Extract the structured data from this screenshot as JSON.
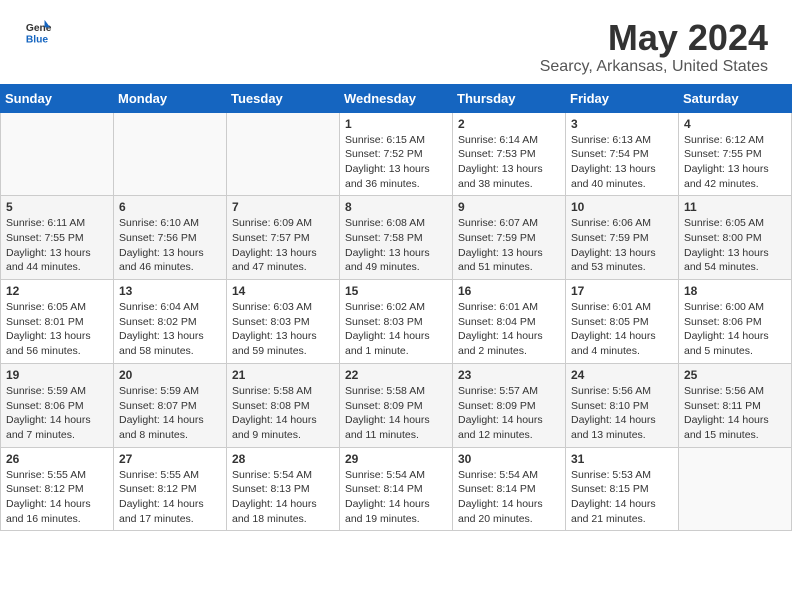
{
  "header": {
    "logo": {
      "line1": "General",
      "line2": "Blue"
    },
    "title": "May 2024",
    "location": "Searcy, Arkansas, United States"
  },
  "weekdays": [
    "Sunday",
    "Monday",
    "Tuesday",
    "Wednesday",
    "Thursday",
    "Friday",
    "Saturday"
  ],
  "weeks": [
    [
      {
        "day": null,
        "data": null
      },
      {
        "day": null,
        "data": null
      },
      {
        "day": null,
        "data": null
      },
      {
        "day": "1",
        "sunrise": "6:15 AM",
        "sunset": "7:52 PM",
        "daylight": "13 hours and 36 minutes."
      },
      {
        "day": "2",
        "sunrise": "6:14 AM",
        "sunset": "7:53 PM",
        "daylight": "13 hours and 38 minutes."
      },
      {
        "day": "3",
        "sunrise": "6:13 AM",
        "sunset": "7:54 PM",
        "daylight": "13 hours and 40 minutes."
      },
      {
        "day": "4",
        "sunrise": "6:12 AM",
        "sunset": "7:55 PM",
        "daylight": "13 hours and 42 minutes."
      }
    ],
    [
      {
        "day": "5",
        "sunrise": "6:11 AM",
        "sunset": "7:55 PM",
        "daylight": "13 hours and 44 minutes."
      },
      {
        "day": "6",
        "sunrise": "6:10 AM",
        "sunset": "7:56 PM",
        "daylight": "13 hours and 46 minutes."
      },
      {
        "day": "7",
        "sunrise": "6:09 AM",
        "sunset": "7:57 PM",
        "daylight": "13 hours and 47 minutes."
      },
      {
        "day": "8",
        "sunrise": "6:08 AM",
        "sunset": "7:58 PM",
        "daylight": "13 hours and 49 minutes."
      },
      {
        "day": "9",
        "sunrise": "6:07 AM",
        "sunset": "7:59 PM",
        "daylight": "13 hours and 51 minutes."
      },
      {
        "day": "10",
        "sunrise": "6:06 AM",
        "sunset": "7:59 PM",
        "daylight": "13 hours and 53 minutes."
      },
      {
        "day": "11",
        "sunrise": "6:05 AM",
        "sunset": "8:00 PM",
        "daylight": "13 hours and 54 minutes."
      }
    ],
    [
      {
        "day": "12",
        "sunrise": "6:05 AM",
        "sunset": "8:01 PM",
        "daylight": "13 hours and 56 minutes."
      },
      {
        "day": "13",
        "sunrise": "6:04 AM",
        "sunset": "8:02 PM",
        "daylight": "13 hours and 58 minutes."
      },
      {
        "day": "14",
        "sunrise": "6:03 AM",
        "sunset": "8:03 PM",
        "daylight": "13 hours and 59 minutes."
      },
      {
        "day": "15",
        "sunrise": "6:02 AM",
        "sunset": "8:03 PM",
        "daylight": "14 hours and 1 minute."
      },
      {
        "day": "16",
        "sunrise": "6:01 AM",
        "sunset": "8:04 PM",
        "daylight": "14 hours and 2 minutes."
      },
      {
        "day": "17",
        "sunrise": "6:01 AM",
        "sunset": "8:05 PM",
        "daylight": "14 hours and 4 minutes."
      },
      {
        "day": "18",
        "sunrise": "6:00 AM",
        "sunset": "8:06 PM",
        "daylight": "14 hours and 5 minutes."
      }
    ],
    [
      {
        "day": "19",
        "sunrise": "5:59 AM",
        "sunset": "8:06 PM",
        "daylight": "14 hours and 7 minutes."
      },
      {
        "day": "20",
        "sunrise": "5:59 AM",
        "sunset": "8:07 PM",
        "daylight": "14 hours and 8 minutes."
      },
      {
        "day": "21",
        "sunrise": "5:58 AM",
        "sunset": "8:08 PM",
        "daylight": "14 hours and 9 minutes."
      },
      {
        "day": "22",
        "sunrise": "5:58 AM",
        "sunset": "8:09 PM",
        "daylight": "14 hours and 11 minutes."
      },
      {
        "day": "23",
        "sunrise": "5:57 AM",
        "sunset": "8:09 PM",
        "daylight": "14 hours and 12 minutes."
      },
      {
        "day": "24",
        "sunrise": "5:56 AM",
        "sunset": "8:10 PM",
        "daylight": "14 hours and 13 minutes."
      },
      {
        "day": "25",
        "sunrise": "5:56 AM",
        "sunset": "8:11 PM",
        "daylight": "14 hours and 15 minutes."
      }
    ],
    [
      {
        "day": "26",
        "sunrise": "5:55 AM",
        "sunset": "8:12 PM",
        "daylight": "14 hours and 16 minutes."
      },
      {
        "day": "27",
        "sunrise": "5:55 AM",
        "sunset": "8:12 PM",
        "daylight": "14 hours and 17 minutes."
      },
      {
        "day": "28",
        "sunrise": "5:54 AM",
        "sunset": "8:13 PM",
        "daylight": "14 hours and 18 minutes."
      },
      {
        "day": "29",
        "sunrise": "5:54 AM",
        "sunset": "8:14 PM",
        "daylight": "14 hours and 19 minutes."
      },
      {
        "day": "30",
        "sunrise": "5:54 AM",
        "sunset": "8:14 PM",
        "daylight": "14 hours and 20 minutes."
      },
      {
        "day": "31",
        "sunrise": "5:53 AM",
        "sunset": "8:15 PM",
        "daylight": "14 hours and 21 minutes."
      },
      {
        "day": null,
        "data": null
      }
    ]
  ]
}
